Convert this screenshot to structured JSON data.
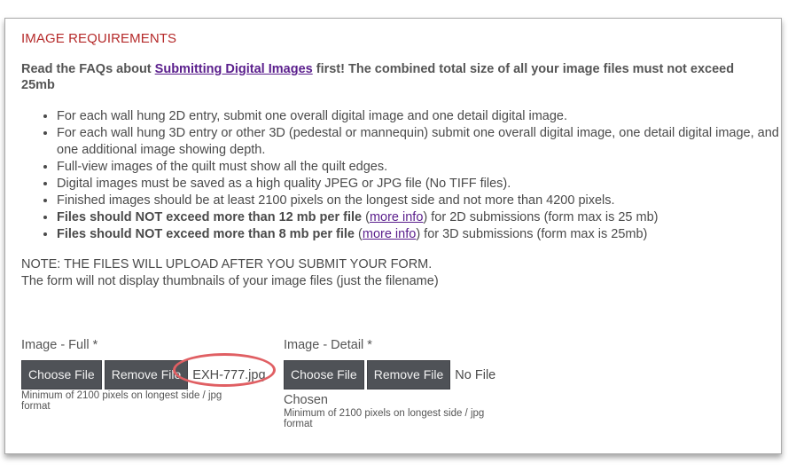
{
  "section": {
    "heading": "IMAGE REQUIREMENTS",
    "intro_before": "Read the FAQs about ",
    "intro_link": "Submitting Digital Images",
    "intro_after": " first! The combined total size of all your image files must not exceed 25mb"
  },
  "requirements": [
    {
      "text": "For each wall hung 2D entry, submit one overall digital image and one detail digital image."
    },
    {
      "text": "For each wall hung 3D entry or other 3D (pedestal or mannequin) submit one overall digital image, one detail digital image, and one additional image showing depth."
    },
    {
      "text": "Full-view images of the quilt must show all the quilt edges."
    },
    {
      "text": "Digital images must be saved as a high quality JPEG or JPG file (No TIFF files)."
    },
    {
      "text": "Finished images should be at least 2100 pixels on the longest side and not more than 4200 pixels."
    },
    {
      "bold": "Files should NOT exceed more than 12 mb per file",
      "open": " (",
      "link": "more info",
      "after": ") for 2D submissions (form max is 25 mb)"
    },
    {
      "bold": "Files should NOT exceed more than 8 mb per file",
      "open": " (",
      "link": "more info",
      "after": ") for 3D submissions (form max is 25mb)"
    }
  ],
  "note": {
    "line1": "NOTE: THE FILES WILL UPLOAD AFTER YOU SUBMIT YOUR FORM.",
    "line2": "The form will not display thumbnails of your image files (just the filename)"
  },
  "fields": {
    "full": {
      "label": "Image - Full  *",
      "choose_label": "Choose File",
      "remove_label": "Remove File",
      "filename": "EXH-777.jpg",
      "hint": "Minimum of 2100 pixels on longest side / jpg format"
    },
    "detail": {
      "label": "Image - Detail  *",
      "choose_label": "Choose File",
      "remove_label": "Remove File",
      "filename": "No File",
      "filename_cont": "Chosen",
      "hint": "Minimum of 2100 pixels on longest side / jpg format"
    }
  },
  "colors": {
    "heading": "#b52a2a",
    "link": "#5a1e8c",
    "button_bg": "#4f5257",
    "highlight_circle": "#e05f63"
  }
}
